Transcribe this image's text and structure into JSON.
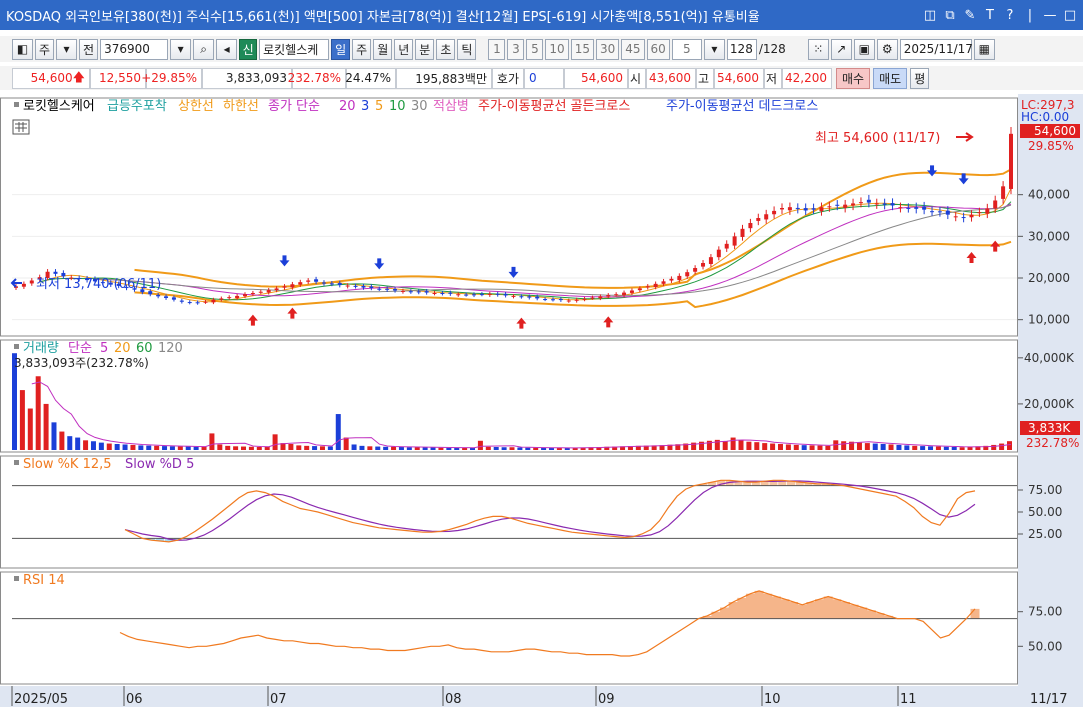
{
  "titlebar": {
    "text": "KOSDAQ 외국인보유[380(천)] 주식수[15,661(천)] 액면[500] 자본금[78(억)] 결산[12월] EPS[-619] 시가총액[8,551(억)] 유통비율",
    "icons": [
      "◫",
      "⧉",
      "✎",
      "T",
      "?",
      "|",
      "—",
      "□"
    ]
  },
  "toolbar": {
    "mode": "주",
    "prev_label": "전",
    "code": "376900",
    "stock_name": "로킷헬스케",
    "new_badge": "신",
    "periods": [
      "일",
      "주",
      "월",
      "년",
      "분",
      "초",
      "틱"
    ],
    "active_period": "일",
    "intervals": [
      "1",
      "3",
      "5",
      "10",
      "15",
      "30",
      "45",
      "60"
    ],
    "interval_select": "5",
    "count": "128",
    "count_total": "/128",
    "date": "2025/11/17"
  },
  "quote": {
    "price": "54,600",
    "change": "12,550",
    "change_pct": "+29.85%",
    "volume": "3,833,093",
    "volume_ratio": "232.78%",
    "turnover": "24.47%",
    "amount": "195,883백만",
    "quote_label": "호가",
    "quote_value": "0",
    "quote_price": "54,600",
    "open_label": "시",
    "open": "43,600",
    "high_label": "고",
    "high": "54,600",
    "low_label": "저",
    "low": "42,200",
    "buy_label": "매수",
    "sell_label": "매도",
    "eval_label": "평"
  },
  "price_panel": {
    "legend": [
      {
        "text": "로킷헬스케어",
        "color": "#000000"
      },
      {
        "text": "급등주포착",
        "color": "#1fa0a0"
      },
      {
        "text": "상한선",
        "color": "#f09a18"
      },
      {
        "text": "하한선",
        "color": "#f09a18"
      },
      {
        "text": "종가 단순",
        "color": "#c030c0"
      },
      {
        "text": "20",
        "color": "#c030c0"
      },
      {
        "text": "3",
        "color": "#1b3fd8"
      },
      {
        "text": "5",
        "color": "#f09a18"
      },
      {
        "text": "10",
        "color": "#1f9a40"
      },
      {
        "text": "30",
        "color": "#888888"
      },
      {
        "text": "적삼병",
        "color": "#e060c0"
      },
      {
        "text": "주가-이동평균선 골든크로스",
        "color": "#e02020"
      },
      {
        "text": "주가-이동평균선 데드크로스",
        "color": "#1b3fd8"
      }
    ],
    "lc": "LC:297,3",
    "hc": "HC:0.00",
    "high_annotation": "최고 54,600 (11/17)",
    "low_annotation": "최저 13,740 (06/11)",
    "axis_ticks": [
      "40,000",
      "30,000",
      "20,000",
      "10,000"
    ],
    "last_price_tag": "54,600",
    "last_pct_tag": "29.85%"
  },
  "volume_panel": {
    "legend": [
      {
        "text": "거래량",
        "color": "#1fa0a0"
      },
      {
        "text": "단순",
        "color": "#c030c0"
      },
      {
        "text": "5",
        "color": "#c030c0"
      },
      {
        "text": "20",
        "color": "#f09a18"
      },
      {
        "text": "60",
        "color": "#1f9a40"
      },
      {
        "text": "120",
        "color": "#888888"
      }
    ],
    "current": "3,833,093주(232.78%)",
    "axis_ticks": [
      "40,000K",
      "20,000K"
    ],
    "last_tag": "3,833K",
    "last_pct": "232.78%"
  },
  "stoch_panel": {
    "legend": [
      {
        "text": "Slow %K 12,5",
        "color": "#f07a20"
      },
      {
        "text": "Slow %D 5",
        "color": "#8a2ab0"
      }
    ],
    "axis_ticks": [
      "75.00",
      "50.00",
      "25.00"
    ]
  },
  "rsi_panel": {
    "legend": [
      {
        "text": "RSI 14",
        "color": "#f07a20"
      }
    ],
    "axis_ticks": [
      "75.00",
      "50.00"
    ]
  },
  "x_axis": {
    "labels": [
      "2025/05",
      "06",
      "07",
      "08",
      "09",
      "10",
      "11"
    ],
    "last_label": "11/17"
  },
  "colors": {
    "up": "#e02020",
    "down": "#1b3fd8",
    "band": "#f09a18",
    "panel_bg": "#ffffff",
    "axis_bg": "#dfe6f2"
  },
  "chart_data": {
    "type": "candlestick",
    "x_axis_labels": [
      "2025/05",
      "06",
      "07",
      "08",
      "09",
      "10",
      "11"
    ],
    "y_axis_ticks": [
      10000,
      20000,
      30000,
      40000
    ],
    "high": {
      "value": 54600,
      "date": "11/17"
    },
    "low": {
      "value": 13740,
      "date": "06/11"
    },
    "close_series": [
      18000,
      18600,
      19400,
      20200,
      21500,
      21000,
      20400,
      20100,
      19800,
      19500,
      19200,
      18900,
      18400,
      18100,
      17600,
      17200,
      16600,
      16100,
      15600,
      15200,
      14800,
      14300,
      14100,
      14000,
      14300,
      14800,
      15100,
      15400,
      15700,
      16100,
      16400,
      16700,
      17100,
      17500,
      18000,
      18500,
      19000,
      19400,
      19100,
      18700,
      18600,
      18300,
      18200,
      18000,
      17700,
      17600,
      17400,
      17200,
      17000,
      16900,
      16700,
      16600,
      16500,
      16400,
      16300,
      16200,
      16100,
      16000,
      15900,
      16100,
      16200,
      16000,
      15800,
      15700,
      15500,
      15300,
      15100,
      14900,
      14800,
      14700,
      14600,
      14800,
      15000,
      15300,
      15600,
      15900,
      16100,
      16500,
      17000,
      17500,
      18000,
      18600,
      19200,
      19800,
      20500,
      21400,
      22400,
      23600,
      25000,
      26800,
      28200,
      30000,
      31800,
      33200,
      34400,
      35300,
      36100,
      36800,
      37000,
      36600,
      36200,
      36400,
      37000,
      37200,
      37400,
      37600,
      37900,
      38200,
      38100,
      37900,
      37600,
      37400,
      37000,
      36800,
      36600,
      36400,
      36000,
      35800,
      35200,
      34800,
      34400,
      35200,
      35800,
      36700,
      38600,
      42000,
      54600
    ],
    "volume_series_k": [
      42000,
      26000,
      18000,
      32000,
      20000,
      12000,
      8000,
      6000,
      5400,
      4200,
      3800,
      3200,
      2800,
      2600,
      2400,
      2200,
      2000,
      1900,
      1800,
      1700,
      1600,
      1500,
      1500,
      1400,
      1400,
      7200,
      2400,
      1800,
      1600,
      1500,
      1400,
      1300,
      1300,
      6800,
      3000,
      2600,
      2000,
      1800,
      1700,
      1600,
      1500,
      15600,
      5400,
      2400,
      1800,
      1600,
      1500,
      1400,
      1400,
      1300,
      1200,
      1200,
      1100,
      1100,
      1000,
      1000,
      1000,
      1000,
      1000,
      4000,
      1400,
      1300,
      1200,
      1200,
      1100,
      1000,
      1000,
      900,
      900,
      900,
      900,
      1000,
      1100,
      1200,
      1300,
      1400,
      1500,
      1600,
      1700,
      1800,
      1900,
      2000,
      2100,
      2300,
      2500,
      2800,
      3200,
      3600,
      4000,
      4400,
      3800,
      5400,
      4200,
      3600,
      3400,
      3000,
      2800,
      2600,
      2400,
      2200,
      2100,
      2000,
      1900,
      1800,
      4200,
      3800,
      3600,
      3200,
      3000,
      2800,
      2600,
      2400,
      2200,
      2000,
      1800,
      1700,
      1600,
      1500,
      1400,
      1300,
      1200,
      1400,
      1600,
      1800,
      2200,
      2800,
      3833
    ],
    "stoch_k": [
      30,
      25,
      20,
      18,
      17,
      16,
      18,
      22,
      28,
      35,
      42,
      50,
      58,
      66,
      72,
      74,
      72,
      68,
      62,
      58,
      54,
      52,
      50,
      47,
      44,
      41,
      38,
      36,
      34,
      32,
      31,
      30,
      29,
      28,
      27,
      27,
      28,
      30,
      33,
      36,
      40,
      43,
      45,
      45,
      43,
      40,
      37,
      35,
      33,
      31,
      29,
      27,
      26,
      25,
      24,
      23,
      22,
      21,
      22,
      25,
      30,
      40,
      55,
      68,
      76,
      80,
      82,
      84,
      86,
      86,
      85,
      84,
      84,
      85,
      86,
      86,
      85,
      84,
      83,
      82,
      82,
      81,
      80,
      78,
      76,
      74,
      72,
      70,
      68,
      62,
      55,
      45,
      38,
      35,
      48,
      65,
      72,
      74
    ],
    "rsi": [
      60,
      57,
      55,
      54,
      53,
      52,
      51,
      50,
      49,
      50,
      50,
      51,
      52,
      54,
      56,
      57,
      58,
      56,
      55,
      54,
      54,
      53,
      52,
      52,
      51,
      50,
      50,
      49,
      49,
      48,
      48,
      47,
      47,
      47,
      48,
      49,
      50,
      50,
      51,
      49,
      48,
      48,
      47,
      46,
      46,
      46,
      47,
      48,
      48,
      47,
      46,
      46,
      45,
      45,
      44,
      44,
      44,
      44,
      43,
      43,
      44,
      46,
      50,
      54,
      58,
      62,
      66,
      70,
      72,
      75,
      78,
      82,
      85,
      88,
      90,
      88,
      86,
      84,
      82,
      80,
      82,
      84,
      86,
      84,
      82,
      80,
      78,
      76,
      74,
      72,
      70,
      70,
      70,
      68,
      62,
      56,
      58,
      64,
      70,
      77
    ]
  }
}
